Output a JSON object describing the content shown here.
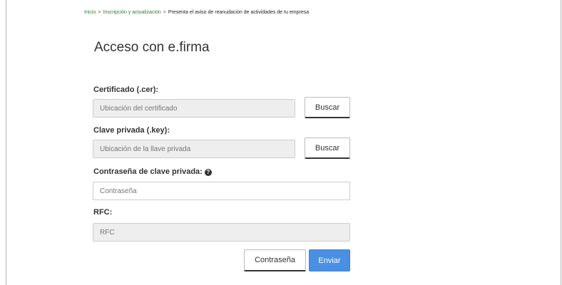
{
  "breadcrumb": {
    "home": "Inicio",
    "separator": ">",
    "section": "Inscripción y actualización",
    "current": "Presenta el aviso de reanudación de actividades de tu empresa"
  },
  "page_title": "Acceso con e.firma",
  "form": {
    "cert_label": "Certificado (.cer):",
    "cert_placeholder": "Ubicación del certificado",
    "cert_button": "Buscar",
    "key_label": "Clave privada (.key):",
    "key_placeholder": "Ubicación de la llave privada",
    "key_button": "Buscar",
    "password_label": "Contraseña de clave privada:",
    "password_help_icon": "question-circle-icon",
    "password_placeholder": "Contraseña",
    "rfc_label": "RFC:",
    "rfc_placeholder": "RFC",
    "contrasena_button": "Contraseña",
    "send_button": "Enviar"
  },
  "colors": {
    "breadcrumb_link": "#2e7d32",
    "primary_button": "#4a90e2",
    "disabled_input": "#eeeeee"
  }
}
